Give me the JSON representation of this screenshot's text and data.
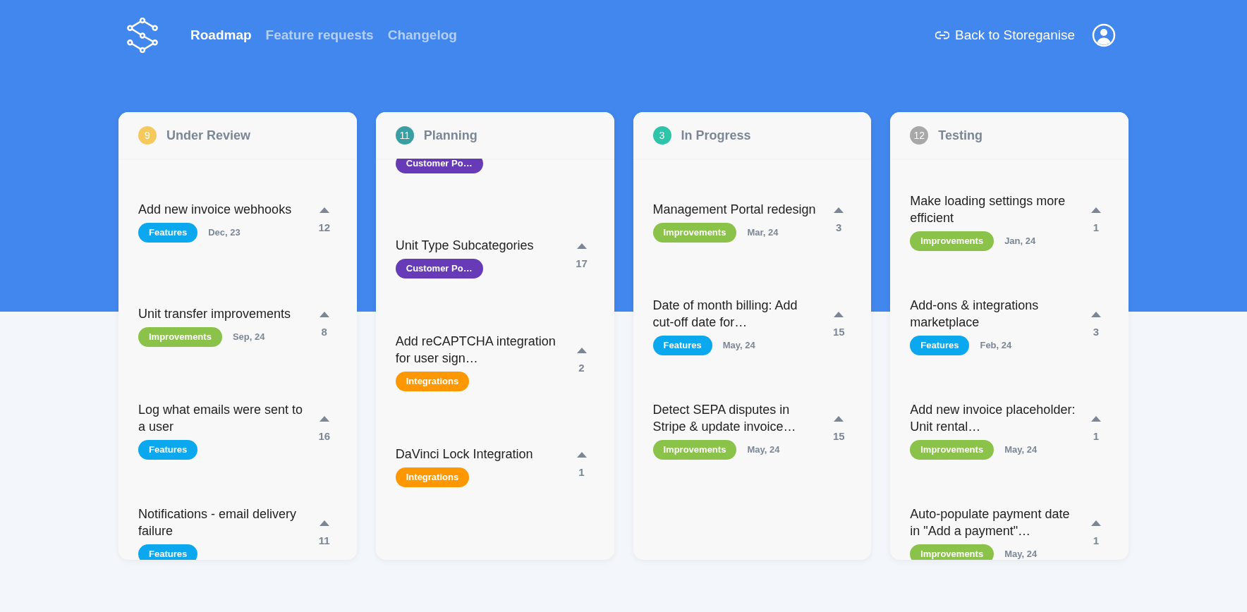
{
  "nav": {
    "links": [
      {
        "label": "Roadmap",
        "selected": true
      },
      {
        "label": "Feature requests",
        "selected": false
      },
      {
        "label": "Changelog",
        "selected": false
      }
    ],
    "back_link": "Back to Storeganise"
  },
  "columns": [
    {
      "title": "Under Review",
      "count": "9",
      "color": "#f6c95c",
      "items": [
        {
          "kind": "card",
          "title": "Add new invoice webhooks",
          "tag": {
            "label": "Features",
            "color": "#0ba8ef"
          },
          "date": "Dec, 23",
          "votes": "12"
        },
        {
          "kind": "card",
          "title": "Unit transfer improvements",
          "tag": {
            "label": "Improvements",
            "color": "#8bc34a"
          },
          "date": "Sep, 24",
          "votes": "8"
        },
        {
          "kind": "card",
          "title": "Log what emails were sent to a user",
          "tag": {
            "label": "Features",
            "color": "#0ba8ef"
          },
          "votes": "16"
        },
        {
          "kind": "card",
          "title": "Notifications - email delivery failure",
          "tag": {
            "label": "Features",
            "color": "#0ba8ef"
          },
          "votes": "11"
        }
      ]
    },
    {
      "title": "Planning",
      "count": "11",
      "color": "#3a9fa3",
      "items": [
        {
          "kind": "partial",
          "tag": {
            "label": "Customer Po…",
            "color": "#673ab7"
          }
        },
        {
          "kind": "card",
          "title": "Unit Type Subcategories",
          "tag": {
            "label": "Customer Po…",
            "color": "#673ab7"
          },
          "votes": "17"
        },
        {
          "kind": "card",
          "title": "Add reCAPTCHA integration for user sign…",
          "tag": {
            "label": "Integrations",
            "color": "#ff9800"
          },
          "votes": "2"
        },
        {
          "kind": "card",
          "title": "DaVinci Lock Integration",
          "tag": {
            "label": "Integrations",
            "color": "#ff9800"
          },
          "votes": "1"
        }
      ]
    },
    {
      "title": "In Progress",
      "count": "3",
      "color": "#2ec4aa",
      "items": [
        {
          "kind": "card",
          "title": "Management Portal redesign",
          "tag": {
            "label": "Improvements",
            "color": "#8bc34a"
          },
          "date": "Mar, 24",
          "votes": "3"
        },
        {
          "kind": "card",
          "title": "Date of month billing: Add cut-off date for…",
          "tag": {
            "label": "Features",
            "color": "#0ba8ef"
          },
          "date": "May, 24",
          "votes": "15"
        },
        {
          "kind": "card",
          "title": "Detect SEPA disputes in Stripe & update invoice…",
          "tag": {
            "label": "Improvements",
            "color": "#8bc34a"
          },
          "date": "May, 24",
          "votes": "15"
        }
      ]
    },
    {
      "title": "Testing",
      "count": "12",
      "color": "#a8a8a8",
      "items": [
        {
          "kind": "card",
          "title": "Make loading settings more efficient",
          "tag": {
            "label": "Improvements",
            "color": "#8bc34a"
          },
          "date": "Jan, 24",
          "votes": "1"
        },
        {
          "kind": "card",
          "title": "Add-ons & integrations marketplace",
          "tag": {
            "label": "Features",
            "color": "#0ba8ef"
          },
          "date": "Feb, 24",
          "votes": "3"
        },
        {
          "kind": "card",
          "title": "Add new invoice placeholder: Unit rental…",
          "tag": {
            "label": "Improvements",
            "color": "#8bc34a"
          },
          "date": "May, 24",
          "votes": "1"
        },
        {
          "kind": "card",
          "title": "Auto-populate payment date in \"Add a payment\"…",
          "tag": {
            "label": "Improvements",
            "color": "#8bc34a"
          },
          "date": "May, 24",
          "votes": "1"
        }
      ]
    }
  ]
}
